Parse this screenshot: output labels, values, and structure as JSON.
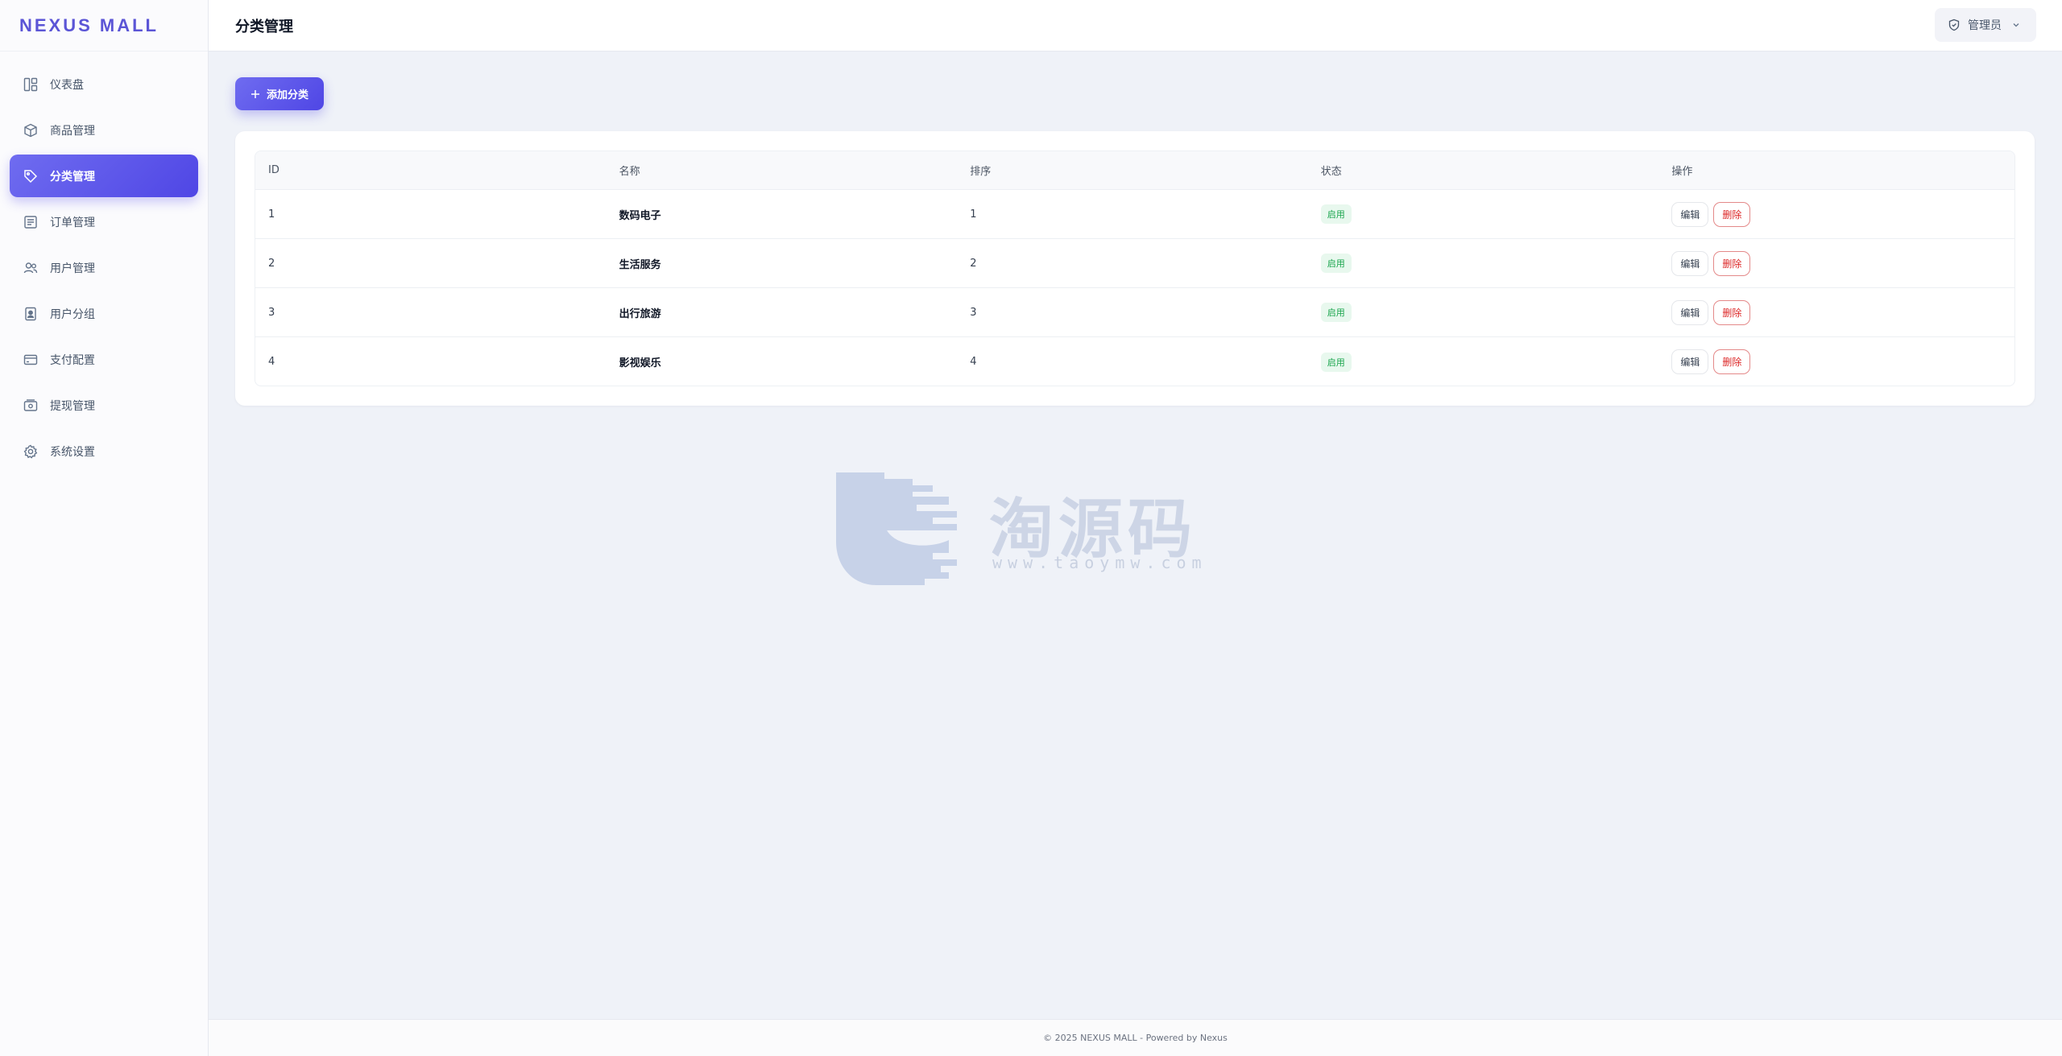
{
  "brand": "NEXUS MALL",
  "sidebar": {
    "items": [
      {
        "label": "仪表盘",
        "icon": "dashboard-icon"
      },
      {
        "label": "商品管理",
        "icon": "box-icon"
      },
      {
        "label": "分类管理",
        "icon": "tag-icon",
        "active": true
      },
      {
        "label": "订单管理",
        "icon": "order-icon"
      },
      {
        "label": "用户管理",
        "icon": "users-icon"
      },
      {
        "label": "用户分组",
        "icon": "user-group-icon"
      },
      {
        "label": "支付配置",
        "icon": "credit-card-icon"
      },
      {
        "label": "提现管理",
        "icon": "withdraw-icon"
      },
      {
        "label": "系统设置",
        "icon": "gear-icon"
      }
    ]
  },
  "header": {
    "title": "分类管理",
    "user_label": "管理员"
  },
  "toolbar": {
    "add_label": "添加分类"
  },
  "table": {
    "columns": [
      "ID",
      "名称",
      "排序",
      "状态",
      "操作"
    ],
    "rows": [
      {
        "id": "1",
        "name": "数码电子",
        "sort": "1",
        "status": "启用"
      },
      {
        "id": "2",
        "name": "生活服务",
        "sort": "2",
        "status": "启用"
      },
      {
        "id": "3",
        "name": "出行旅游",
        "sort": "3",
        "status": "启用"
      },
      {
        "id": "4",
        "name": "影视娱乐",
        "sort": "4",
        "status": "启用"
      }
    ],
    "edit_label": "编辑",
    "delete_label": "删除"
  },
  "watermark": {
    "text": "淘源码",
    "url": "www.taoymw.com"
  },
  "footer": {
    "text": "© 2025 NEXUS MALL - Powered by Nexus"
  },
  "colors": {
    "accent": "#4f46e5",
    "success": "#16a34a",
    "danger": "#dc2626"
  }
}
